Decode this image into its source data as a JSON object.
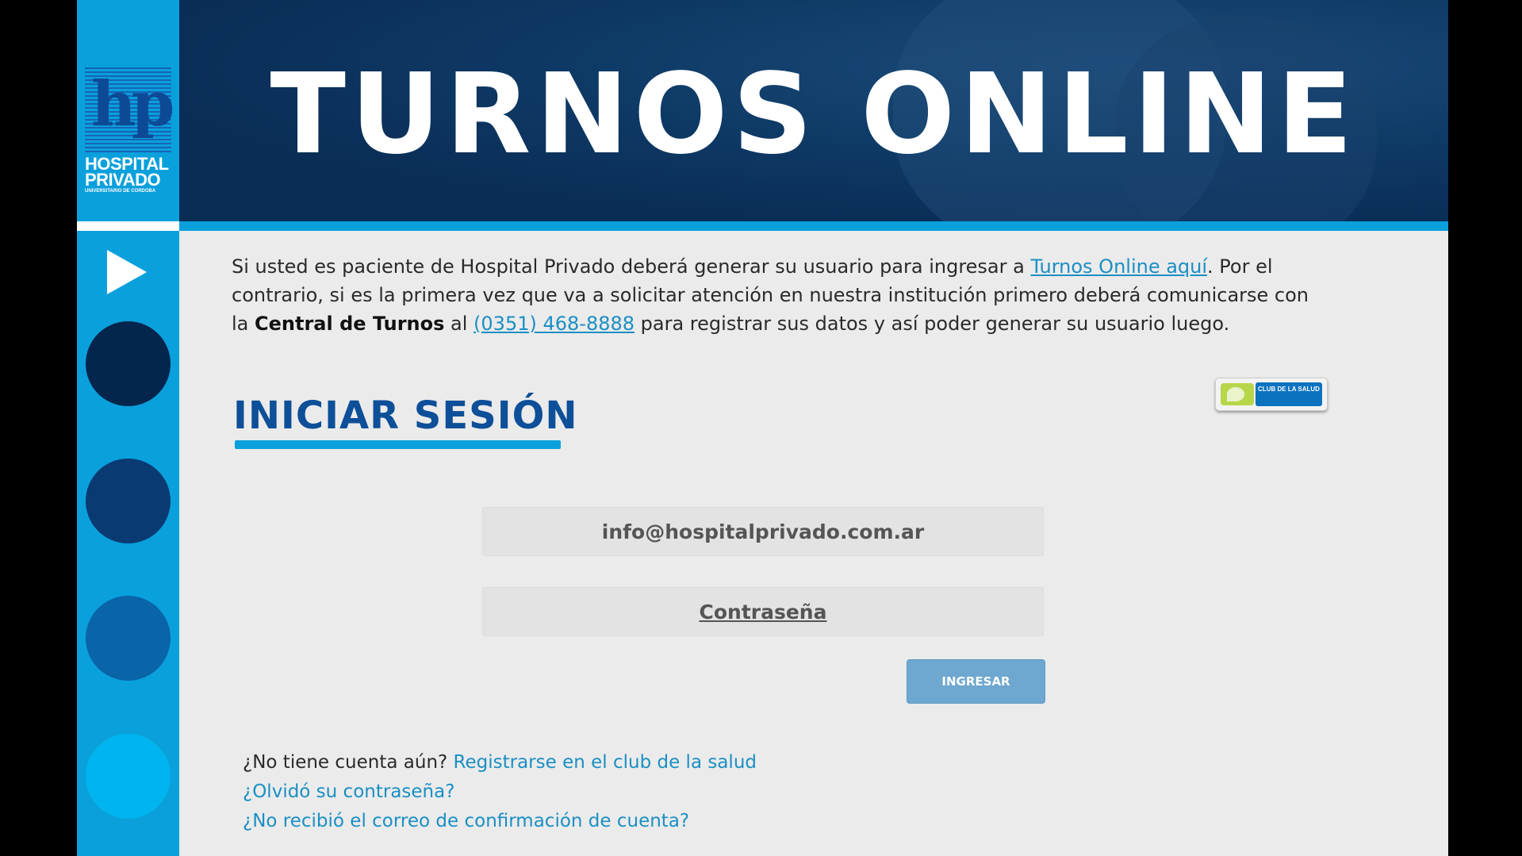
{
  "brand": {
    "logo_mark": "hp",
    "logo_name": "HOSPITAL PRIVADO",
    "logo_subtitle": "UNIVERSITARIO DE CORDOBA"
  },
  "banner": {
    "title": "TURNOS ONLINE"
  },
  "sidebar": {
    "play_icon": "play-icon",
    "dots": [
      {
        "name": "nav-dot-1",
        "color": "#04264d"
      },
      {
        "name": "nav-dot-2",
        "color": "#0a3a72"
      },
      {
        "name": "nav-dot-3",
        "color": "#0a64a8"
      },
      {
        "name": "nav-dot-4",
        "color": "#00b5ef"
      }
    ]
  },
  "intro": {
    "part1": "Si usted es paciente de Hospital Privado deberá generar su usuario para ingresar a ",
    "link1": "Turnos Online aquí",
    "part2": ". Por el contrario, si es la primera vez que va a solicitar atención en nuestra institución primero deberá comunicarse con la ",
    "bold": "Central de Turnos",
    "part3": " al ",
    "phone_link": "(0351) 468-8888",
    "part4": " para registrar sus datos y así poder generar su usuario luego."
  },
  "login": {
    "title": "INICIAR SESIÓN",
    "email_value": "info@hospitalprivado.com.ar",
    "password_placeholder": "Contraseña",
    "submit_label": "INGRESAR",
    "club_badge": "CLUB DE LA SALUD"
  },
  "footer": {
    "no_account_text": "¿No tiene cuenta aún? ",
    "register_link": "Registrarse en el club de la salud",
    "forgot_link": "¿Olvidó su contraseña?",
    "no_email_link": "¿No recibió el correo de confirmación de cuenta?"
  },
  "colors": {
    "accent": "#0aa0dc",
    "navy": "#0d4f98",
    "link": "#1a8fc4",
    "button": "#6ea7cf"
  }
}
